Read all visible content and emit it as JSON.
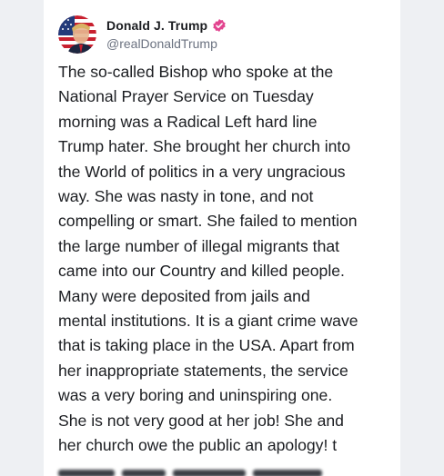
{
  "post": {
    "author": {
      "display_name": "Donald J. Trump",
      "handle": "@realDonaldTrump",
      "verified_icon": "verified-badge-icon",
      "avatar_icon": "avatar-flag-image"
    },
    "text": "The so-called Bishop who spoke at the\nNational Prayer Service on Tuesday\nmorning was a Radical Left hard line\nTrump hater. She brought her church into\nthe World of politics in a very ungracious\nway. She was nasty in tone, and not\ncompelling or smart. She failed to mention\nthe large number of illegal migrants that\ncame into our Country and killed people.\nMany were deposited from jails and\nmental institutions. It is a giant crime wave\nthat is taking place in the USA. Apart from\nher inappropriate statements, the service\nwas a very boring and uninspiring one.\nShe is not very good at her job! She and\nher church owe the public an apology! t"
  },
  "colors": {
    "background": "#eef0f3",
    "card": "#ffffff",
    "text_primary": "#1b1d21",
    "text_secondary": "#6b7280",
    "verified_badge": "#e2448f"
  }
}
